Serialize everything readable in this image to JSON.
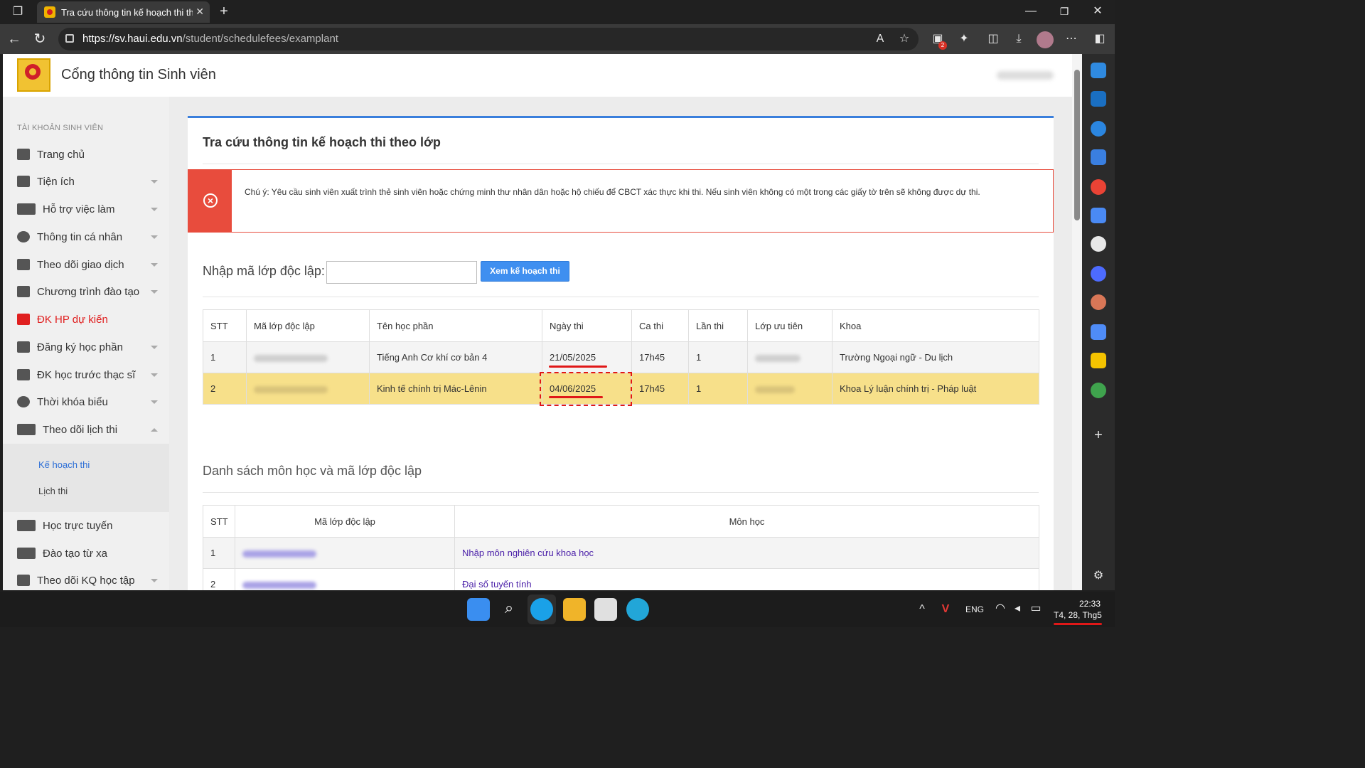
{
  "browser": {
    "tab_title": "Tra cứu thông tin kế hoạch thi theo lớp",
    "url_host": "https://sv.haui.edu.vn",
    "url_path": "/student/schedulefees/examplant",
    "notification_count": "2"
  },
  "header": {
    "portal_title": "Cổng thông tin Sinh viên"
  },
  "sidebar": {
    "heading": "TÀI KHOẢN SINH VIÊN",
    "items": [
      {
        "label": "Trang chủ"
      },
      {
        "label": "Tiện ích"
      },
      {
        "label": "Hỗ trợ việc làm"
      },
      {
        "label": "Thông tin cá nhân"
      },
      {
        "label": "Theo dõi giao dịch"
      },
      {
        "label": "Chương trình đào tạo"
      },
      {
        "label": "ĐK HP dự kiến"
      },
      {
        "label": "Đăng ký học phần"
      },
      {
        "label": "ĐK học trước thạc sĩ"
      },
      {
        "label": "Thời khóa biểu"
      },
      {
        "label": "Theo dõi lịch thi"
      },
      {
        "label": "Học trực tuyến"
      },
      {
        "label": "Đào tạo từ xa"
      },
      {
        "label": "Theo dõi KQ học tập"
      }
    ],
    "sub_items": [
      {
        "label": "Kế hoạch thi"
      },
      {
        "label": "Lịch thi"
      }
    ]
  },
  "main": {
    "title": "Tra cứu thông tin kế hoạch thi theo lớp",
    "alert": "Chú ý: Yêu cầu sinh viên xuất trình thẻ sinh viên hoặc chứng minh thư nhân dân hoặc hộ chiếu để CBCT xác thực khi thi. Nếu sinh viên không có một trong các giấy tờ trên sẽ không được dự thi.",
    "lookup_label": "Nhập mã lớp độc lập:",
    "lookup_value": "",
    "lookup_button": "Xem kế hoạch thi",
    "exam_table": {
      "headers": [
        "STT",
        "Mã lớp độc lập",
        "Tên học phần",
        "Ngày thi",
        "Ca thi",
        "Lần thi",
        "Lớp ưu tiên",
        "Khoa"
      ],
      "rows": [
        {
          "stt": "1",
          "course": "Tiếng Anh Cơ khí cơ bản 4",
          "date": "21/05/2025",
          "shift": "17h45",
          "attempt": "1",
          "faculty": "Trường Ngoại ngữ - Du lịch"
        },
        {
          "stt": "2",
          "course": "Kinh tế chính trị Mác-Lênin",
          "date": "04/06/2025",
          "shift": "17h45",
          "attempt": "1",
          "faculty": "Khoa Lý luận chính trị - Pháp luật"
        }
      ]
    },
    "list_title": "Danh sách môn học và mã lớp độc lập",
    "list_table": {
      "headers": [
        "STT",
        "Mã lớp độc lập",
        "Môn học"
      ],
      "rows": [
        {
          "stt": "1",
          "subject": "Nhập môn nghiên cứu khoa học"
        },
        {
          "stt": "2",
          "subject": "Đại số tuyến tính"
        }
      ]
    }
  },
  "taskbar": {
    "lang": "ENG",
    "time": "22:33",
    "date": "T4, 28, Thg5"
  }
}
